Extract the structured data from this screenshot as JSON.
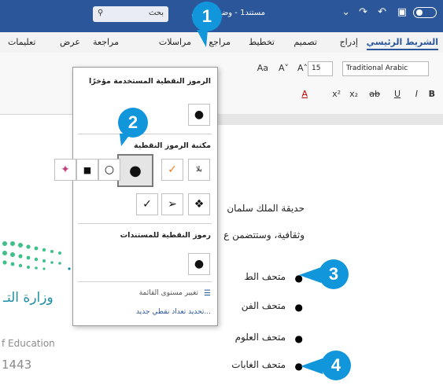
{
  "titlebar": {
    "doc_title": "مستند1 - وضع التوافق",
    "search_label": "بحث",
    "qa_icons": [
      "save-icon",
      "undo-icon",
      "redo-icon",
      "customize-icon"
    ]
  },
  "tabs": {
    "home": "الشريط الرئيسي",
    "insert": "إدراج",
    "design": "تصميم",
    "layout": "تخطيط",
    "references": "مراجع",
    "mailings": "مراسلات",
    "review": "مراجعة",
    "view": "عرض",
    "help": "تعليمات"
  },
  "ribbon": {
    "font_name": "Traditional Arabic",
    "font_size": "15",
    "glyphs": [
      "Aa",
      "A˄",
      "A˅",
      "B",
      "I",
      "U",
      "ab",
      "x₂",
      "x²",
      "A"
    ]
  },
  "panel": {
    "recent_heading": "الرموز النقطية المستخدمة مؤخرًا",
    "library_heading": "مكتبة الرموز النقطية",
    "document_heading": "رموز النقطية للمستندات",
    "none_label": "بلا",
    "change_level": "تغيير مستوى القائمة",
    "define_new": "تحديد تعداد نقطي جديد...",
    "symbols": {
      "recent": "●",
      "library": [
        "✓",
        "●",
        "○",
        "■",
        "✦",
        "❖",
        "➢",
        "✓"
      ],
      "document": "●"
    }
  },
  "document": {
    "lines": [
      "حديقة الملك سلمان",
      "وثقافية، وستتضمن ع"
    ],
    "bullets": [
      "متحف الط",
      "متحف الفن",
      "متحف العلوم",
      "متحف الغابات"
    ]
  },
  "badges": [
    "1",
    "2",
    "3",
    "4"
  ],
  "logo": {
    "arabic": "وزارة التـ",
    "english": "f Education",
    "year": "1443"
  },
  "colors": {
    "title_bar": "#2b579a",
    "badge": "#1296db"
  }
}
